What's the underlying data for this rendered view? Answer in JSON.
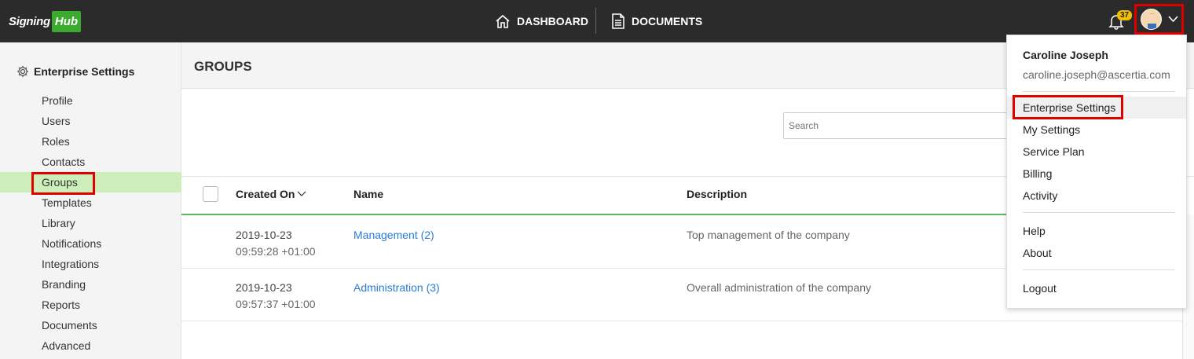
{
  "brand": {
    "part1": "Signing",
    "part2": "Hub",
    "accent": "#3aab2e"
  },
  "topnav": {
    "dashboard": "DASHBOARD",
    "documents": "DOCUMENTS"
  },
  "notifications": {
    "count": "37"
  },
  "sidebar": {
    "heading": "Enterprise Settings",
    "items": [
      "Profile",
      "Users",
      "Roles",
      "Contacts",
      "Groups",
      "Templates",
      "Library",
      "Notifications",
      "Integrations",
      "Branding",
      "Reports",
      "Documents",
      "Advanced"
    ],
    "active": "Groups"
  },
  "main": {
    "title": "GROUPS",
    "search_placeholder": "Search",
    "columns": {
      "created_on": "Created On",
      "name": "Name",
      "description": "Description"
    },
    "rows": [
      {
        "date": "2019-10-23",
        "time": "09:59:28 +01:00",
        "name": "Management (2)",
        "description": "Top management of the company"
      },
      {
        "date": "2019-10-23",
        "time": "09:57:37 +01:00",
        "name": "Administration (3)",
        "description": "Overall administration of the company"
      }
    ]
  },
  "user_menu": {
    "name": "Caroline Joseph",
    "email": "caroline.joseph@ascertia.com",
    "items": [
      "Enterprise Settings",
      "My Settings",
      "Service Plan",
      "Billing",
      "Activity"
    ],
    "help": [
      "Help",
      "About"
    ],
    "logout": "Logout"
  },
  "colors": {
    "highlight_outline": "#e00000",
    "link": "#2a7bd4",
    "active_bg": "#cdeebb",
    "table_accent": "#5cb85c"
  }
}
